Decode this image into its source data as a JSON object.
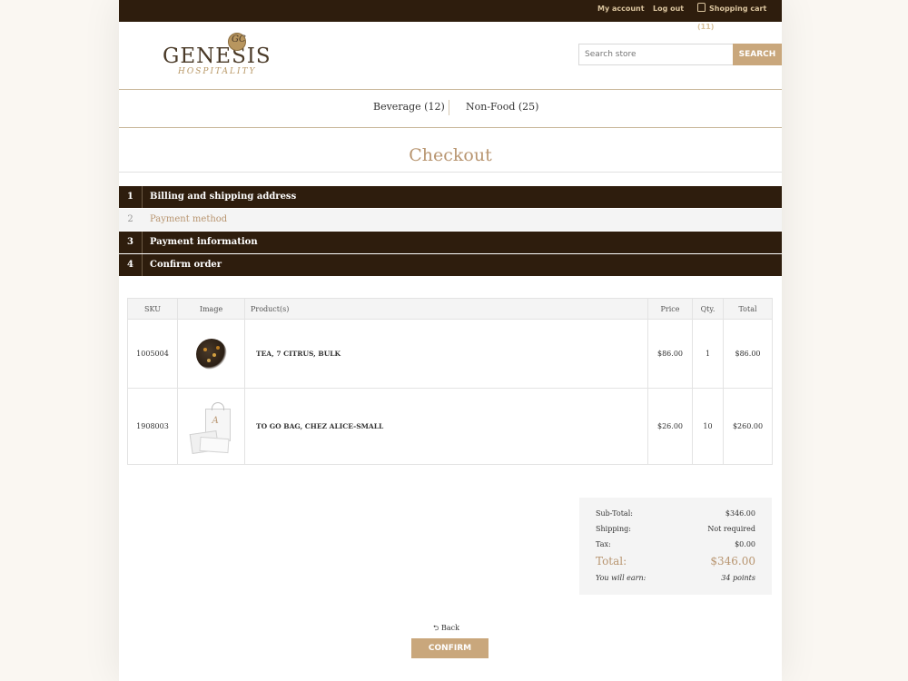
{
  "topbar": {
    "my_account": "My account",
    "log_out": "Log out",
    "shopping_cart": "Shopping cart (11)"
  },
  "logo": {
    "name": "GENESIS",
    "subtitle": "HOSPITALITY",
    "emblem": "GC"
  },
  "search": {
    "placeholder": "Search store",
    "button": "SEARCH"
  },
  "categories": [
    {
      "label": "Beverage (12)"
    },
    {
      "label": "Non-Food (25)"
    }
  ],
  "page_title": "Checkout",
  "steps": [
    {
      "num": "1",
      "label": "Billing and shipping address",
      "active": false
    },
    {
      "num": "2",
      "label": "Payment method",
      "active": true
    },
    {
      "num": "3",
      "label": "Payment information",
      "active": false
    },
    {
      "num": "4",
      "label": "Confirm order",
      "active": false
    }
  ],
  "cart": {
    "headers": [
      "SKU",
      "Image",
      "Product(s)",
      "Price",
      "Qty.",
      "Total"
    ],
    "rows": [
      {
        "sku": "1005004",
        "image": "tea-leaves",
        "product": "TEA, 7 CITRUS, BULK",
        "price": "$86.00",
        "qty": "1",
        "total": "$86.00"
      },
      {
        "sku": "1908003",
        "image": "paper-bag",
        "product": "TO GO BAG, CHEZ ALICE-SMALL",
        "price": "$26.00",
        "qty": "10",
        "total": "$260.00"
      }
    ]
  },
  "totals": {
    "subtotal_label": "Sub-Total:",
    "subtotal_value": "$346.00",
    "shipping_label": "Shipping:",
    "shipping_value": "Not required",
    "tax_label": "Tax:",
    "tax_value": "$0.00",
    "total_label": "Total:",
    "total_value": "$346.00",
    "earn_label": "You will earn:",
    "earn_value": "34 points"
  },
  "actions": {
    "back": "Back",
    "back_icon": "return-arrow-icon",
    "confirm": "CONFIRM"
  },
  "colors": {
    "dark_brown": "#2e1d0d",
    "accent_tan": "#c9a77c",
    "title_gold": "#b89570"
  }
}
